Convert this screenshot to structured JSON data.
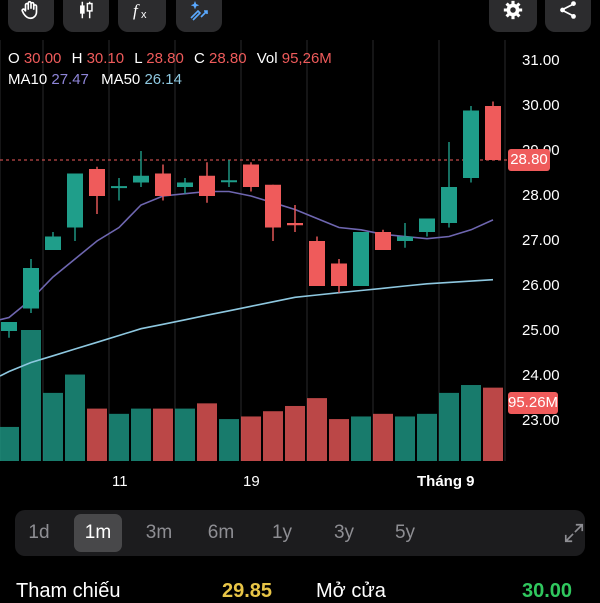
{
  "toolbar": {
    "left": [
      "drawing-hand-icon",
      "candlestick-type-icon",
      "indicator-fx-icon",
      "magic-ai-icon"
    ],
    "right": [
      "settings-gear-icon",
      "share-icon"
    ]
  },
  "ohlc": {
    "o_label": "O",
    "o": "30.00",
    "h_label": "H",
    "h": "30.10",
    "l_label": "L",
    "l": "28.80",
    "c_label": "C",
    "c": "28.80",
    "vol_label": "Vol",
    "vol": "95,26M"
  },
  "ma": {
    "ma10_label": "MA10",
    "ma10": "27.47",
    "ma50_label": "MA50",
    "ma50": "26.14"
  },
  "axis": {
    "price_ticks": [
      "31.00",
      "30.00",
      "29.00",
      "28.00",
      "27.00",
      "26.00",
      "25.00",
      "24.00",
      "23.00"
    ],
    "current_price_tag": "28.80",
    "volume_tag": "95.26M",
    "x_ticks": [
      "11",
      "19",
      "Tháng 9"
    ]
  },
  "colors": {
    "up": "#1f9e8a",
    "down": "#ef5b5b",
    "ma10": "#6e66b0",
    "ma50": "#8ec8e0",
    "active_bg": "#48484a"
  },
  "chart_data": {
    "type": "candlestick",
    "ylim": [
      22.0,
      31.0
    ],
    "candles": [
      {
        "o": 25.0,
        "h": 25.2,
        "l": 24.85,
        "c": 25.2,
        "vol": 26
      },
      {
        "o": 25.5,
        "h": 26.6,
        "l": 25.4,
        "c": 26.4,
        "vol": 100
      },
      {
        "o": 26.8,
        "h": 27.2,
        "l": 26.8,
        "c": 27.1,
        "vol": 52
      },
      {
        "o": 27.3,
        "h": 28.5,
        "l": 27.0,
        "c": 28.5,
        "vol": 66
      },
      {
        "o": 28.6,
        "h": 28.65,
        "l": 27.6,
        "c": 28.0,
        "vol": 40
      },
      {
        "o": 28.18,
        "h": 28.4,
        "l": 27.9,
        "c": 28.22,
        "vol": 36
      },
      {
        "o": 28.3,
        "h": 29.0,
        "l": 28.2,
        "c": 28.45,
        "vol": 40
      },
      {
        "o": 28.5,
        "h": 28.7,
        "l": 27.9,
        "c": 28.0,
        "vol": 40
      },
      {
        "o": 28.2,
        "h": 28.4,
        "l": 28.05,
        "c": 28.3,
        "vol": 40
      },
      {
        "o": 28.45,
        "h": 28.75,
        "l": 27.85,
        "c": 28.0,
        "vol": 44
      },
      {
        "o": 28.35,
        "h": 28.8,
        "l": 28.2,
        "c": 28.35,
        "vol": 32
      },
      {
        "o": 28.7,
        "h": 28.75,
        "l": 28.1,
        "c": 28.2,
        "vol": 34
      },
      {
        "o": 28.25,
        "h": 28.25,
        "l": 27.0,
        "c": 27.3,
        "vol": 38
      },
      {
        "o": 27.4,
        "h": 27.8,
        "l": 27.2,
        "c": 27.35,
        "vol": 42
      },
      {
        "o": 27.0,
        "h": 27.1,
        "l": 26.0,
        "c": 26.0,
        "vol": 48
      },
      {
        "o": 26.5,
        "h": 26.6,
        "l": 25.85,
        "c": 26.0,
        "vol": 32
      },
      {
        "o": 26.0,
        "h": 27.2,
        "l": 26.0,
        "c": 27.2,
        "vol": 34
      },
      {
        "o": 27.2,
        "h": 27.25,
        "l": 26.8,
        "c": 26.8,
        "vol": 36
      },
      {
        "o": 27.0,
        "h": 27.4,
        "l": 26.85,
        "c": 27.1,
        "vol": 34
      },
      {
        "o": 27.2,
        "h": 27.5,
        "l": 27.1,
        "c": 27.5,
        "vol": 36
      },
      {
        "o": 27.4,
        "h": 29.2,
        "l": 27.3,
        "c": 28.2,
        "vol": 52
      },
      {
        "o": 28.4,
        "h": 30.0,
        "l": 28.3,
        "c": 29.9,
        "vol": 58
      },
      {
        "o": 30.0,
        "h": 30.1,
        "l": 28.8,
        "c": 28.8,
        "vol": 56
      }
    ],
    "ma10": [
      25.3,
      25.7,
      26.2,
      26.6,
      27.0,
      27.3,
      27.8,
      28.0,
      28.05,
      28.1,
      28.1,
      28.0,
      27.85,
      27.7,
      27.5,
      27.3,
      27.25,
      27.15,
      27.1,
      27.05,
      27.1,
      27.25,
      27.47
    ],
    "ma50": [
      24.1,
      24.3,
      24.45,
      24.6,
      24.75,
      24.9,
      25.05,
      25.15,
      25.25,
      25.35,
      25.45,
      25.55,
      25.65,
      25.75,
      25.8,
      25.85,
      25.9,
      25.95,
      26.0,
      26.05,
      26.08,
      26.11,
      26.14
    ]
  },
  "periods": [
    "1d",
    "1m",
    "3m",
    "6m",
    "1y",
    "3y",
    "5y"
  ],
  "active_period": "1m",
  "stats": {
    "ref_label": "Tham chiếu",
    "ref_value": "29.85",
    "open_label": "Mở cửa",
    "open_value": "30.00"
  }
}
